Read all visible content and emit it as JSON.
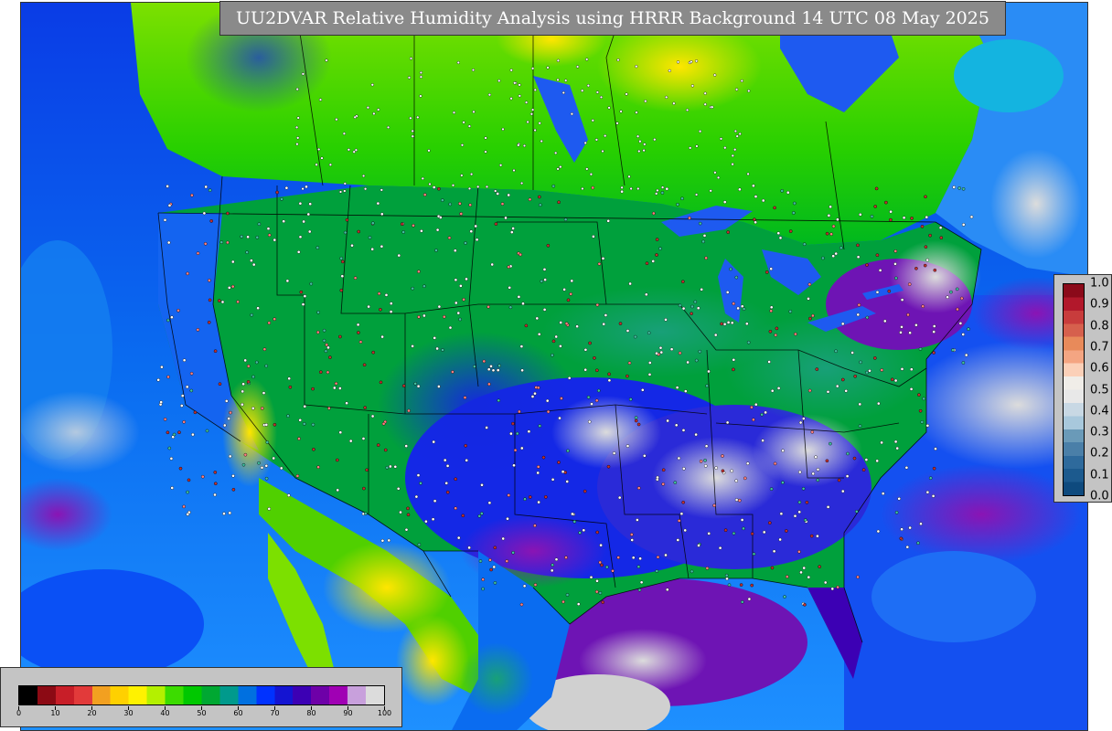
{
  "title": "UU2DVAR Relative Humidity Analysis using HRRR Background 14 UTC 08 May 2025",
  "rh_colorbar": {
    "ticks": [
      "0",
      "10",
      "20",
      "30",
      "40",
      "50",
      "60",
      "70",
      "80",
      "90",
      "100"
    ],
    "colors": [
      "#000000",
      "#8c0a14",
      "#c81e28",
      "#e23a3a",
      "#f2a020",
      "#ffd000",
      "#fff200",
      "#b4f000",
      "#3cdc00",
      "#00c800",
      "#00a832",
      "#009a8c",
      "#0070e0",
      "#0032ff",
      "#1414d2",
      "#3c00b4",
      "#6e00a8",
      "#a000b4",
      "#c8a0dc",
      "#dcdcdc"
    ]
  },
  "anomaly_colorbar": {
    "ticks": [
      "1.0",
      "0.9",
      "0.8",
      "0.7",
      "0.6",
      "0.5",
      "0.4",
      "0.3",
      "0.2",
      "0.1",
      "0.0"
    ],
    "colors": [
      "#8b0a1a",
      "#b2182b",
      "#c83c3c",
      "#d6604d",
      "#e88a5a",
      "#f4a582",
      "#fbd0b8",
      "#f0ede8",
      "#e8e8e8",
      "#c8d8e4",
      "#a8c8dc",
      "#6a9ab8",
      "#4a7fa8",
      "#2e6a9c",
      "#1c5a8e",
      "#0e4a7e"
    ]
  }
}
